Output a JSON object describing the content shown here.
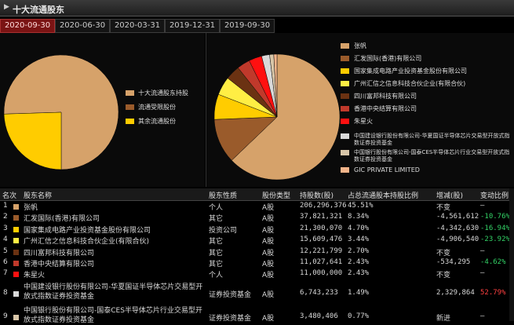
{
  "header": {
    "title": "十大流通股东"
  },
  "tabs": [
    "2020-09-30",
    "2020-06-30",
    "2020-03-31",
    "2019-12-31",
    "2019-09-30"
  ],
  "left_legend": [
    {
      "label": "十大流通股东持股",
      "color": "#d6a26a"
    },
    {
      "label": "流通受限股份",
      "color": "#9a5b2b"
    },
    {
      "label": "其余流通股份",
      "color": "#ffcc00"
    }
  ],
  "right_legend": [
    {
      "label": "张帆",
      "color": "#d6a26a"
    },
    {
      "label": "汇发国际(香港)有限公司",
      "color": "#9a5b2b"
    },
    {
      "label": "国家集成电路产业投资基金股份有限公司",
      "color": "#ffcc00"
    },
    {
      "label": "广州汇信之信息科技合伙企业(有限合伙)",
      "color": "#ffee44"
    },
    {
      "label": "四川富邦科技有限公司",
      "color": "#6b3212"
    },
    {
      "label": "香港中央结算有限公司",
      "color": "#c0392b"
    },
    {
      "label": "朱星火",
      "color": "#ff1010"
    },
    {
      "label": "中国建设银行股份有限公司-华夏国证半导体芯片交易型开放式指数证券投资基金",
      "color": "#d9d9d9"
    },
    {
      "label": "中国银行股份有限公司-国泰CES半导体芯片行业交易型开放式指数证券投资基金",
      "color": "#d8c6a8"
    },
    {
      "label": "GIC PRIVATE LIMITED",
      "color": "#f2b48a"
    }
  ],
  "chart_data": [
    {
      "type": "pie",
      "slices": [
        {
          "label": "十大流通股东持股",
          "value": 75.5,
          "color": "#d6a26a"
        },
        {
          "label": "其余流通股份",
          "value": 24.5,
          "color": "#ffcc00"
        }
      ]
    },
    {
      "type": "pie",
      "slices": [
        {
          "label": "张帆",
          "value": 45.51,
          "color": "#d6a26a"
        },
        {
          "label": "汇发国际(香港)有限公司",
          "value": 8.34,
          "color": "#9a5b2b"
        },
        {
          "label": "国家集成电路产业投资基金股份有限公司",
          "value": 4.7,
          "color": "#ffcc00"
        },
        {
          "label": "广州汇信之信息科技合伙企业(有限合伙)",
          "value": 3.44,
          "color": "#ffee44"
        },
        {
          "label": "四川富邦科技有限公司",
          "value": 2.7,
          "color": "#6b3212"
        },
        {
          "label": "香港中央结算有限公司",
          "value": 2.43,
          "color": "#c0392b"
        },
        {
          "label": "朱星火",
          "value": 2.43,
          "color": "#ff1010"
        },
        {
          "label": "中国建设银行股份有限公司-华夏国证半导体芯片交易型开放式指数证券投资基金",
          "value": 1.49,
          "color": "#d9d9d9"
        },
        {
          "label": "中国银行股份有限公司-国泰CES半导体芯片行业交易型开放式指数证券投资基金",
          "value": 0.77,
          "color": "#d8c6a8"
        },
        {
          "label": "GIC PRIVATE LIMITED",
          "value": 0.6,
          "color": "#f2b48a"
        }
      ]
    }
  ],
  "table": {
    "headers": [
      "名次",
      "股东名称",
      "股东性质",
      "股份类型",
      "持股数(股)",
      "占总流通股本持股比例",
      "增减(股)",
      "变动比例"
    ],
    "rows": [
      {
        "rank": "1",
        "color": "#d6a26a",
        "name": "张帆",
        "nature": "个人",
        "type": "A股",
        "shares": "206,296,376",
        "ratio": "45.51%",
        "change": "不变",
        "change_ratio": "—",
        "change_class": "",
        "ratio_class": ""
      },
      {
        "rank": "2",
        "color": "#9a5b2b",
        "name": "汇发国际(香港)有限公司",
        "nature": "其它",
        "type": "A股",
        "shares": "37,821,321",
        "ratio": "8.34%",
        "change": "-4,561,612",
        "change_ratio": "-10.76%",
        "change_class": "",
        "ratio_class": "green"
      },
      {
        "rank": "3",
        "color": "#ffcc00",
        "name": "国家集成电路产业投资基金股份有限公司",
        "nature": "投资公司",
        "type": "A股",
        "shares": "21,300,070",
        "ratio": "4.70%",
        "change": "-4,342,630",
        "change_ratio": "-16.94%",
        "change_class": "",
        "ratio_class": "green"
      },
      {
        "rank": "4",
        "color": "#ffee44",
        "name": "广州汇信之信息科技合伙企业(有限合伙)",
        "nature": "其它",
        "type": "A股",
        "shares": "15,609,476",
        "ratio": "3.44%",
        "change": "-4,906,540",
        "change_ratio": "-23.92%",
        "change_class": "",
        "ratio_class": "green"
      },
      {
        "rank": "5",
        "color": "#6b3212",
        "name": "四川富邦科技有限公司",
        "nature": "其它",
        "type": "A股",
        "shares": "12,221,799",
        "ratio": "2.70%",
        "change": "不变",
        "change_ratio": "—",
        "change_class": "",
        "ratio_class": ""
      },
      {
        "rank": "6",
        "color": "#c0392b",
        "name": "香港中央结算有限公司",
        "nature": "其它",
        "type": "A股",
        "shares": "11,027,641",
        "ratio": "2.43%",
        "change": "-534,295",
        "change_ratio": "-4.62%",
        "change_class": "",
        "ratio_class": "green"
      },
      {
        "rank": "7",
        "color": "#ff1010",
        "name": "朱星火",
        "nature": "个人",
        "type": "A股",
        "shares": "11,000,000",
        "ratio": "2.43%",
        "change": "不变",
        "change_ratio": "—",
        "change_class": "",
        "ratio_class": ""
      },
      {
        "rank": "8",
        "color": "#d9d9d9",
        "name": "中国建设银行股份有限公司-华夏国证半导体芯片交易型开放式指数证券投资基金",
        "nature": "证券投资基金",
        "type": "A股",
        "shares": "6,743,233",
        "ratio": "1.49%",
        "change": "2,329,864",
        "change_ratio": "52.79%",
        "change_class": "",
        "ratio_class": "red"
      },
      {
        "rank": "9",
        "color": "#d8c6a8",
        "name": "中国银行股份有限公司-国泰CES半导体芯片行业交易型开放式指数证券投资基金",
        "nature": "证券投资基金",
        "type": "A股",
        "shares": "3,480,406",
        "ratio": "0.77%",
        "change": "新进",
        "change_ratio": "—",
        "change_class": "",
        "ratio_class": ""
      }
    ]
  }
}
